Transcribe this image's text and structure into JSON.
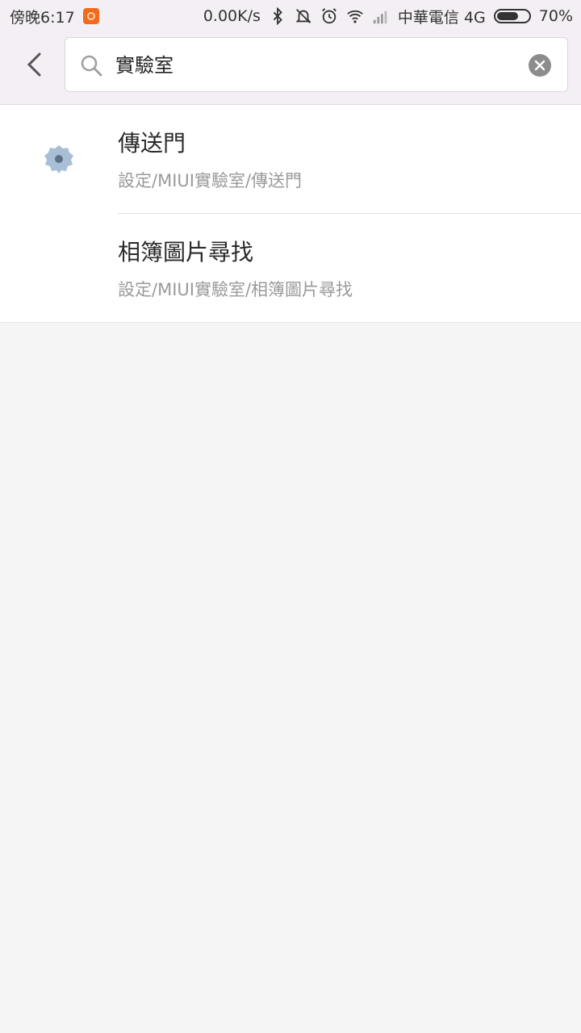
{
  "status_bar": {
    "time": "傍晚6:17",
    "net_speed": "0.00K/s",
    "carrier": "中華電信 4G",
    "battery": "70%",
    "battery_level": 0.7
  },
  "header": {
    "back_icon": "chevron-left-icon",
    "search": {
      "value": "實驗室",
      "icon": "search-icon",
      "clear_icon": "close-icon"
    }
  },
  "results": [
    {
      "title": "傳送門",
      "path": "設定/MIUI實驗室/傳送門",
      "icon": "gear-icon"
    },
    {
      "title": "相簿圖片尋找",
      "path": "設定/MIUI實驗室/相簿圖片尋找",
      "icon": ""
    }
  ],
  "colors": {
    "header_bg": "#f4eff4",
    "page_bg": "#f5f5f5",
    "icon_blue": "#a8bfd6",
    "app_badge": "#f26a1b"
  }
}
